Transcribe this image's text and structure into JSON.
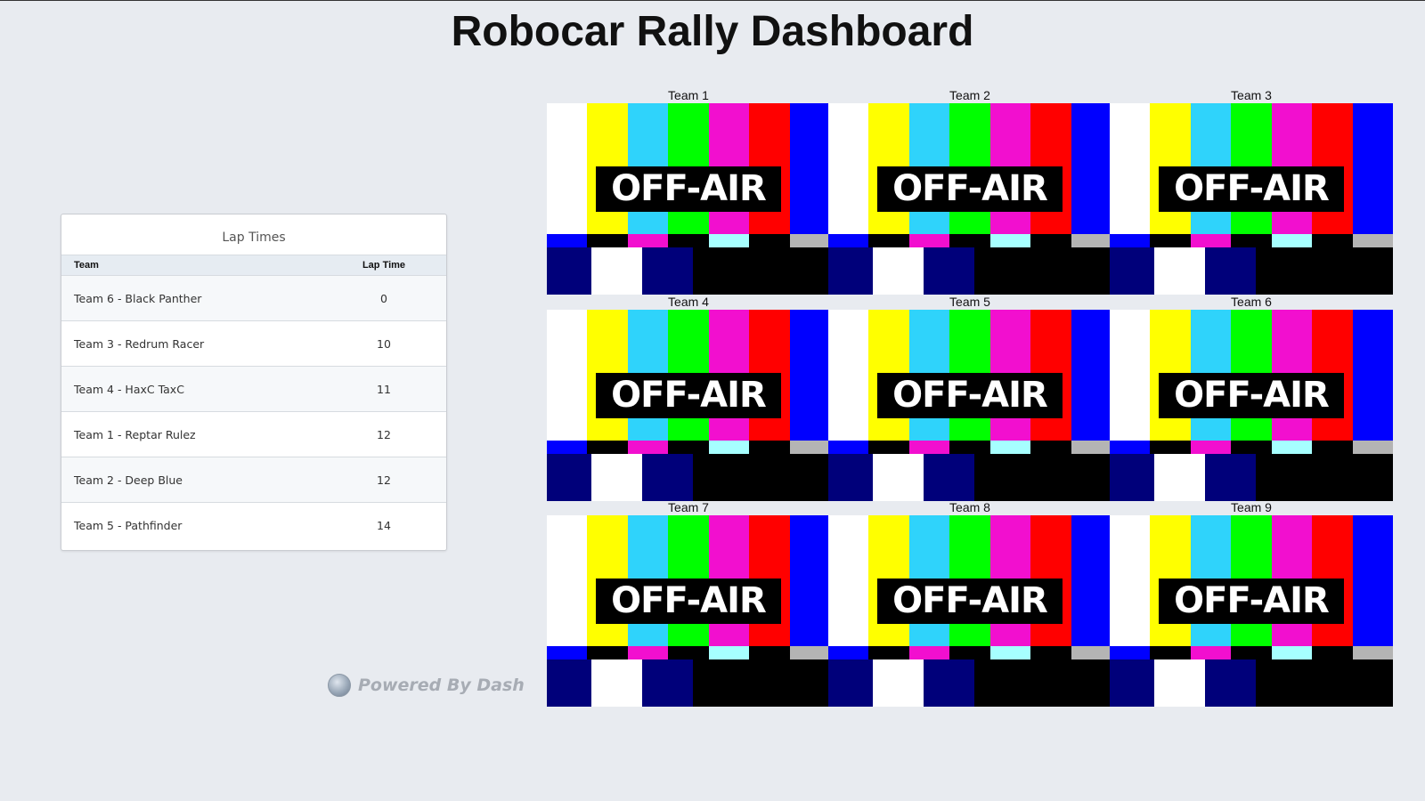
{
  "page": {
    "title": "Robocar Rally Dashboard"
  },
  "lap_times": {
    "title": "Lap Times",
    "columns": {
      "team": "Team",
      "time": "Lap Time"
    },
    "rows": [
      {
        "team": "Team 6 - Black Panther",
        "time": "0"
      },
      {
        "team": "Team 3 - Redrum Racer",
        "time": "10"
      },
      {
        "team": "Team 4 - HaxC TaxC",
        "time": "11"
      },
      {
        "team": "Team 1 - Reptar Rulez",
        "time": "12"
      },
      {
        "team": "Team 2 - Deep Blue",
        "time": "12"
      },
      {
        "team": "Team 5 - Pathfinder",
        "time": "14"
      }
    ]
  },
  "footer": {
    "powered_by": "Powered By Dash",
    "logo_icon": "dash-logo-icon"
  },
  "feeds": [
    {
      "label": "Team 1",
      "status": "OFF-AIR"
    },
    {
      "label": "Team 2",
      "status": "OFF-AIR"
    },
    {
      "label": "Team 3",
      "status": "OFF-AIR"
    },
    {
      "label": "Team 4",
      "status": "OFF-AIR"
    },
    {
      "label": "Team 5",
      "status": "OFF-AIR"
    },
    {
      "label": "Team 6",
      "status": "OFF-AIR"
    },
    {
      "label": "Team 7",
      "status": "OFF-AIR"
    },
    {
      "label": "Team 8",
      "status": "OFF-AIR"
    },
    {
      "label": "Team 9",
      "status": "OFF-AIR"
    }
  ],
  "colors": {
    "background": "#e8ebf0",
    "test_bars_top": [
      "#ffffff",
      "#ffff00",
      "#2fd3fb",
      "#00ff00",
      "#f20fcf",
      "#ff0000",
      "#0000ff"
    ],
    "test_bars_mid": [
      "#0000ff",
      "#000000",
      "#f20fcf",
      "#000000",
      "#a6ffff",
      "#000000",
      "#b4b4b4"
    ],
    "test_bars_bottom": [
      "#00007a",
      "#ffffff",
      "#00007a",
      "#000000",
      "#000000",
      "#000000",
      "#000000"
    ]
  }
}
